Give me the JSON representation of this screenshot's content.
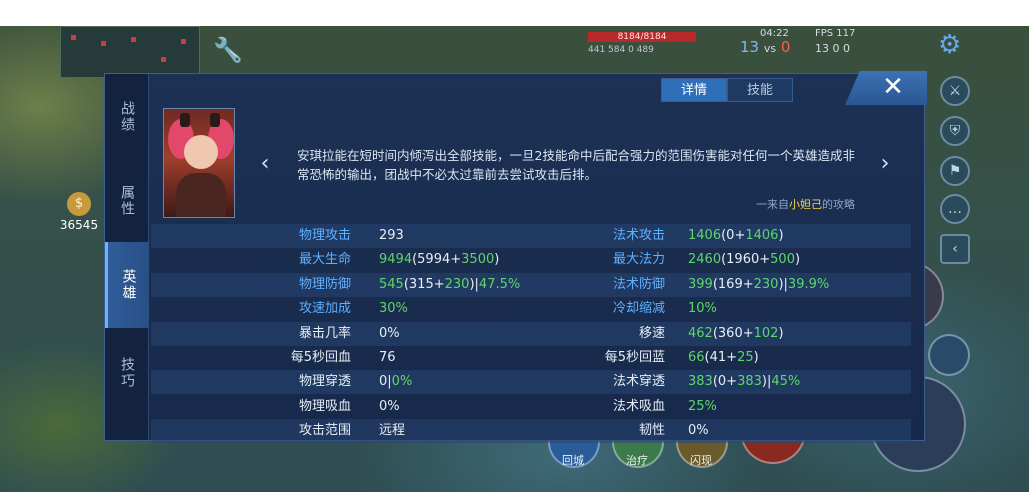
{
  "hud": {
    "hp_text": "8184/8184",
    "kda_text": "441  584  0  489",
    "time": "04:22",
    "score_left": "13",
    "score_vs": "vs",
    "score_right": "0",
    "fps_text": "FPS 117",
    "stats_text": "13  0  0",
    "gold": "36545",
    "summoner_1": "回城",
    "summoner_2": "治疗",
    "summoner_3": "闪现"
  },
  "panel": {
    "left_tabs": [
      "战绩",
      "属性",
      "英雄",
      "技巧"
    ],
    "active_left_tab": "英雄",
    "top_tabs": [
      "详情",
      "技能"
    ],
    "active_top_tab": "详情",
    "close_label": "✕",
    "description": "安琪拉能在短时间内倾泻出全部技能，一旦2技能命中后配合强力的范围伤害能对任何一个英雄造成非常恐怖的输出，团战中不必太过靠前去尝试攻击后排。",
    "source_prefix": "一来自",
    "source_name": "小妲己",
    "source_suffix": "的攻略",
    "prev_arrow": "‹",
    "next_arrow": "›"
  },
  "stats_left": [
    {
      "label": "物理攻击",
      "label_color": "blue",
      "value": "293"
    },
    {
      "label": "最大生命",
      "label_color": "blue",
      "value": "9494(5994+3500)"
    },
    {
      "label": "物理防御",
      "label_color": "blue",
      "value": "545(315+230)|47.5%"
    },
    {
      "label": "攻速加成",
      "label_color": "blue",
      "value": "30%"
    },
    {
      "label": "暴击几率",
      "label_color": "white",
      "value": "0%"
    },
    {
      "label": "每5秒回血",
      "label_color": "white",
      "value": "76"
    },
    {
      "label": "物理穿透",
      "label_color": "white",
      "value": "0|0%"
    },
    {
      "label": "物理吸血",
      "label_color": "white",
      "value": "0%"
    },
    {
      "label": "攻击范围",
      "label_color": "white",
      "value": "远程"
    }
  ],
  "stats_right": [
    {
      "label": "法术攻击",
      "label_color": "blue",
      "value": "1406(0+1406)"
    },
    {
      "label": "最大法力",
      "label_color": "blue",
      "value": "2460(1960+500)"
    },
    {
      "label": "法术防御",
      "label_color": "blue",
      "value": "399(169+230)|39.9%"
    },
    {
      "label": "冷却缩减",
      "label_color": "blue",
      "value": "10%"
    },
    {
      "label": "移速",
      "label_color": "white",
      "value": "462(360+102)"
    },
    {
      "label": "每5秒回蓝",
      "label_color": "white",
      "value": "66(41+25)"
    },
    {
      "label": "法术穿透",
      "label_color": "white",
      "value": "383(0+383)|45%"
    },
    {
      "label": "法术吸血",
      "label_color": "white",
      "value": "25%"
    },
    {
      "label": "韧性",
      "label_color": "white",
      "value": "0%"
    }
  ],
  "colors": {
    "accent_blue": "#5fb0ff",
    "bonus_green": "#5ed66b",
    "panel_bg": "#1c3154"
  }
}
